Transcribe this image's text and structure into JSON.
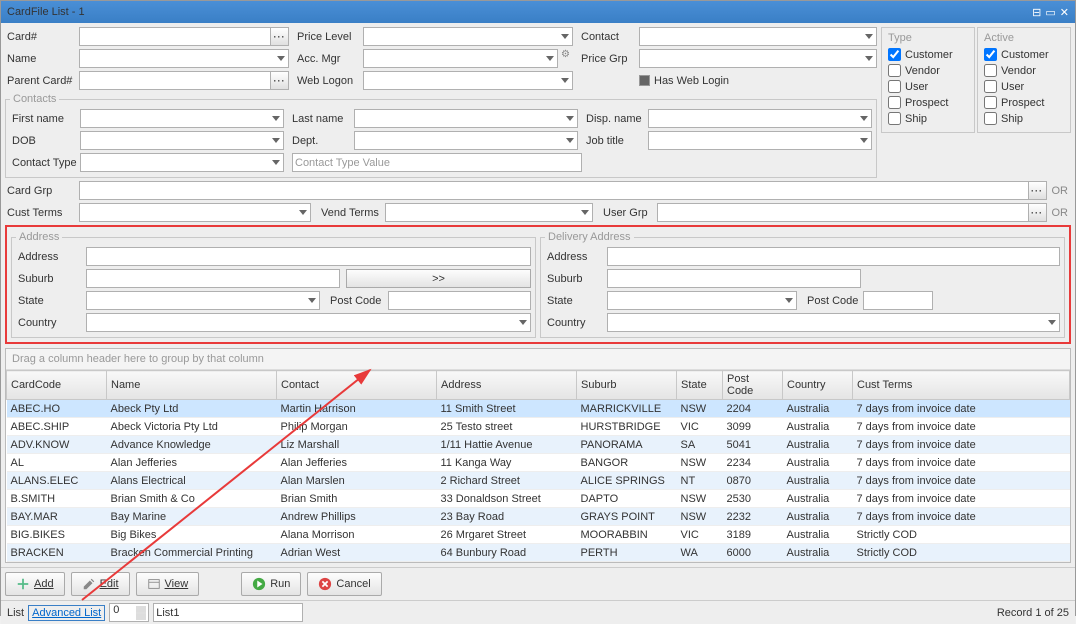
{
  "window": {
    "title": "CardFile List - 1"
  },
  "filters": {
    "card_no": "Card#",
    "price_level": "Price Level",
    "contact": "Contact",
    "name": "Name",
    "acc_mgr": "Acc. Mgr",
    "price_grp": "Price Grp",
    "parent_card": "Parent Card#",
    "web_logon": "Web Logon",
    "has_web": "Has Web Login"
  },
  "contacts": {
    "legend": "Contacts",
    "first_name": "First name",
    "last_name": "Last name",
    "disp_name": "Disp. name",
    "dob": "DOB",
    "dept": "Dept.",
    "job_title": "Job title",
    "contact_type": "Contact Type",
    "ctv_ph": "Contact Type Value"
  },
  "groups": {
    "card_grp": "Card Grp",
    "or": "OR",
    "cust_terms": "Cust Terms",
    "vend_terms": "Vend Terms",
    "user_grp": "User Grp"
  },
  "type_panel": {
    "legend": "Type",
    "active_legend": "Active",
    "items": [
      "Customer",
      "Vendor",
      "User",
      "Prospect",
      "Ship"
    ],
    "type_checked": [
      true,
      false,
      false,
      false,
      false
    ],
    "active_checked": [
      true,
      false,
      false,
      false,
      false
    ]
  },
  "address": {
    "legend": "Address",
    "delivery_legend": "Delivery Address",
    "address": "Address",
    "suburb": "Suburb",
    "state": "State",
    "postcode": "Post Code",
    "country": "Country",
    "copy": ">>"
  },
  "grid": {
    "group_hint": "Drag a column header here to group by that column",
    "headers": [
      "CardCode",
      "Name",
      "Contact",
      "Address",
      "Suburb",
      "State",
      "Post Code",
      "Country",
      "Cust Terms"
    ],
    "rows": [
      [
        "ABEC.HO",
        "Abeck Pty Ltd",
        "Martin Harrison",
        "11 Smith Street",
        "MARRICKVILLE",
        "NSW",
        "2204",
        "Australia",
        "7 days from invoice date"
      ],
      [
        "ABEC.SHIP",
        "Abeck Victoria Pty Ltd",
        "Philip Morgan",
        "25 Testo street",
        "HURSTBRIDGE",
        "VIC",
        "3099",
        "Australia",
        "7 days from invoice date"
      ],
      [
        "ADV.KNOW",
        "Advance Knowledge",
        "Liz Marshall",
        "1/11 Hattie Avenue",
        "PANORAMA",
        "SA",
        "5041",
        "Australia",
        "7 days from invoice date"
      ],
      [
        "AL",
        "Alan Jefferies",
        "Alan Jefferies",
        "11 Kanga Way",
        "BANGOR",
        "NSW",
        "2234",
        "Australia",
        "7 days from invoice date"
      ],
      [
        "ALANS.ELEC",
        "Alans Electrical",
        "Alan Marslen",
        "2 Richard Street",
        "ALICE SPRINGS",
        "NT",
        "0870",
        "Australia",
        "7 days from invoice date"
      ],
      [
        "B.SMITH",
        "Brian Smith & Co",
        "Brian Smith",
        "33 Donaldson Street",
        "DAPTO",
        "NSW",
        "2530",
        "Australia",
        "7 days from invoice date"
      ],
      [
        "BAY.MAR",
        "Bay Marine",
        "Andrew Phillips",
        "23 Bay Road",
        "GRAYS POINT",
        "NSW",
        "2232",
        "Australia",
        "7 days from invoice date"
      ],
      [
        "BIG.BIKES",
        "Big Bikes",
        "Alana Morrison",
        "26 Mrgaret Street",
        "MOORABBIN",
        "VIC",
        "3189",
        "Australia",
        "Strictly COD"
      ],
      [
        "BRACKEN",
        "Bracken Commercial Printing",
        "Adrian West",
        "64 Bunbury Road",
        "PERTH",
        "WA",
        "6000",
        "Australia",
        "Strictly COD"
      ]
    ]
  },
  "toolbar": {
    "add": "Add",
    "edit": "Edit",
    "view": "View",
    "run": "Run",
    "cancel": "Cancel"
  },
  "footer": {
    "list": "List",
    "adv_list": "Advanced List",
    "listno": "0",
    "list_name": "List1",
    "record": "Record 1 of 25"
  }
}
